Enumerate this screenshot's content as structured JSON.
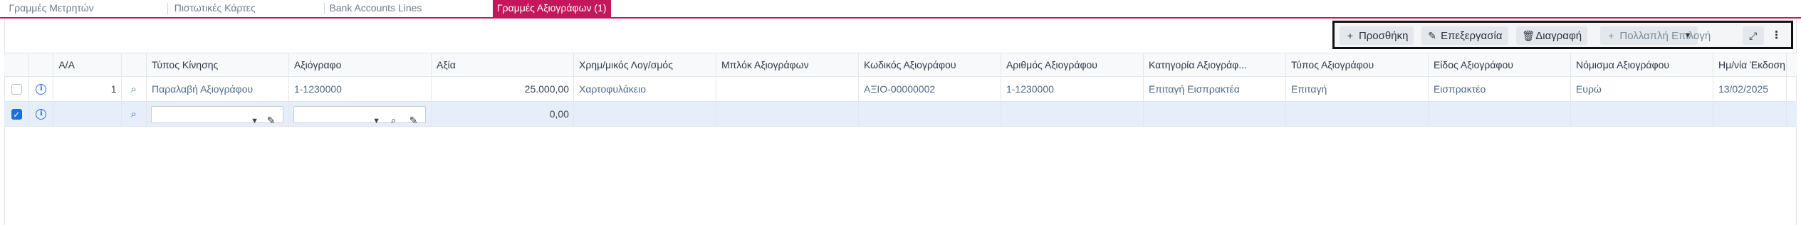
{
  "tabs": [
    {
      "label": "Γραμμές Μετρητών"
    },
    {
      "label": "Πιστωτικές Κάρτες"
    },
    {
      "label": "Bank Accounts Lines"
    },
    {
      "label": "Γραμμές Αξιογράφων (1)"
    }
  ],
  "toolbar": {
    "add_label": "Προσθήκη",
    "edit_label": "Επεξεργασία",
    "delete_label": "Διαγραφή",
    "multi_label": "Πολλαπλή Επιλογή"
  },
  "grid": {
    "columns": [
      "Α/Α",
      "Τύπος Κίνησης",
      "Αξιόγραφο",
      "Αξία",
      "Χρημ/μικός Λογ/σμός",
      "Μπλόκ Αξιογράφων",
      "Κωδικός Αξιογράφου",
      "Αριθμός Αξιογράφου",
      "Κατηγορία Αξιογράφ...",
      "Τύπος Αξιογράφου",
      "Είδος Αξιογράφου",
      "Νόμισμα Αξιογράφου",
      "Ημ/νία Έκδοση"
    ],
    "rows": [
      {
        "aa": "1",
        "movement_type": "Παραλαβή Αξιογράφου",
        "cheque": "1-1230000",
        "value": "25.000,00",
        "account": "Χαρτοφυλάκειο",
        "block": "",
        "code": "ΑΞΙΟ-00000002",
        "number": "1-1230000",
        "category": "Επιταγή Εισπρακτέα",
        "type": "Επιταγή",
        "kind": "Εισπρακτέο",
        "currency": "Ευρώ",
        "issue_date": "13/02/2025"
      },
      {
        "aa": "",
        "movement_type": "",
        "cheque": "",
        "value": "0,00",
        "account": "",
        "block": "",
        "code": "",
        "number": "",
        "category": "",
        "type": "",
        "kind": "",
        "currency": "",
        "issue_date": ""
      }
    ]
  },
  "colors": {
    "accent": "#c2185b",
    "link": "#4f6a86",
    "selected_row": "#e6eef9"
  }
}
